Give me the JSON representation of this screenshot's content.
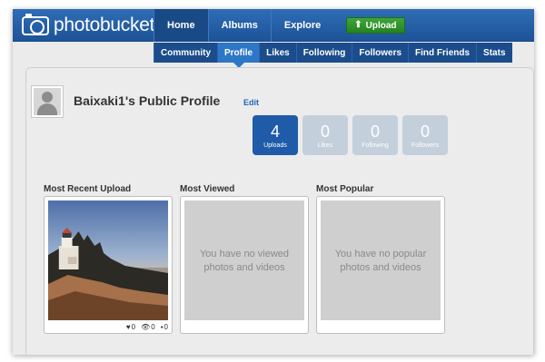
{
  "brand": {
    "name": "photobucket"
  },
  "nav": {
    "main": [
      "Home",
      "Albums",
      "Explore"
    ],
    "upload_label": "Upload",
    "sub": [
      "Community",
      "Profile",
      "Likes",
      "Following",
      "Followers",
      "Find Friends",
      "Stats"
    ]
  },
  "profile": {
    "title": "Baixaki1's Public Profile",
    "edit_label": "Edit",
    "stats": [
      {
        "value": "4",
        "label": "Uploads"
      },
      {
        "value": "0",
        "label": "Likes"
      },
      {
        "value": "0",
        "label": "Following"
      },
      {
        "value": "0",
        "label": "Followers"
      }
    ]
  },
  "sections": {
    "recent": {
      "label": "Most Recent Upload",
      "likes": "0",
      "views": "0",
      "comments": "0"
    },
    "viewed": {
      "label": "Most Viewed",
      "empty": "You have no viewed photos and videos"
    },
    "popular": {
      "label": "Most Popular",
      "empty": "You have no popular photos and videos"
    }
  },
  "colors": {
    "nav_blue": "#1d5398",
    "active_stat": "#1f5ba8",
    "inactive_stat": "#c4cfdc",
    "upload_green": "#2c9a27"
  }
}
